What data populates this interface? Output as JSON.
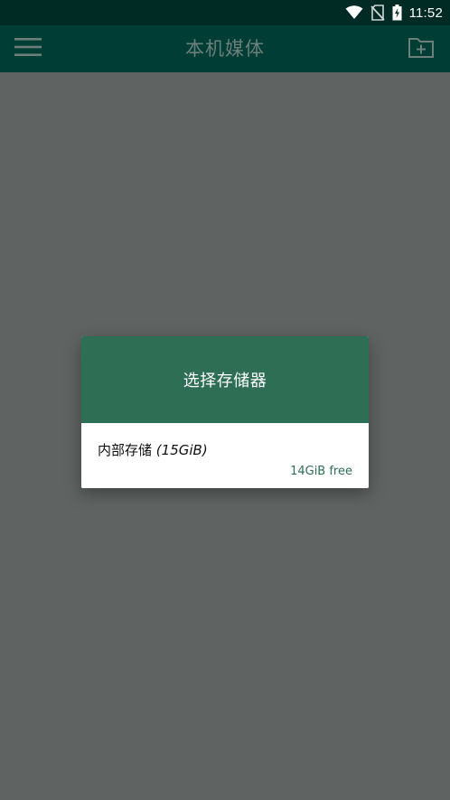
{
  "status_bar": {
    "time": "11:52",
    "icons": [
      "wifi-icon",
      "no-sim-icon",
      "battery-charging-icon"
    ]
  },
  "app_bar": {
    "title": "本机媒体",
    "menu_icon": "menu-icon",
    "action_icon": "add-folder-icon"
  },
  "dialog": {
    "title": "选择存储器",
    "items": [
      {
        "name": "内部存储",
        "size": "(15GiB)",
        "free": "14GiB free"
      }
    ]
  },
  "colors": {
    "status_bar_bg": "#002a24",
    "app_bar_bg": "#003d35",
    "dialog_header_bg": "#2e6e55",
    "scrim": "#5f6462",
    "accent_text": "#2e6e55"
  }
}
